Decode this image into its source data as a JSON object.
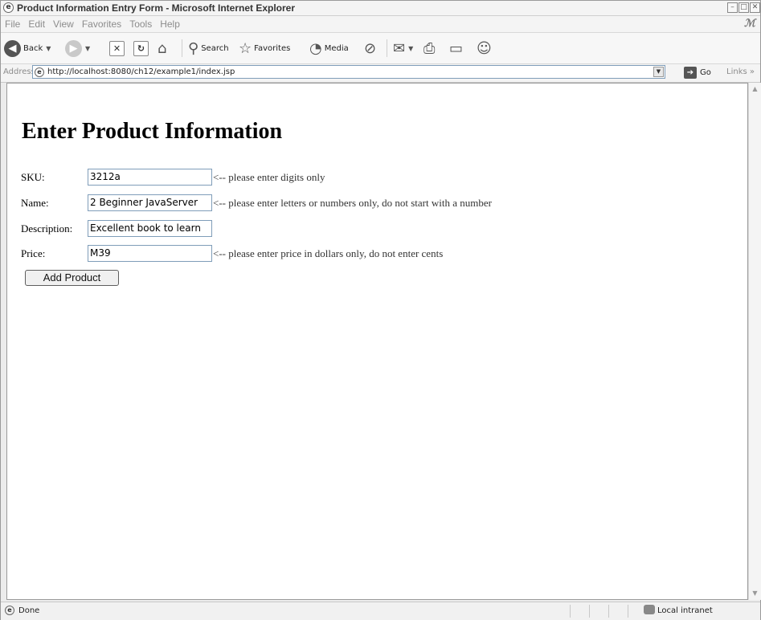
{
  "window": {
    "title": "Product Information Entry Form - Microsoft Internet Explorer",
    "controls": {
      "minimize": "–",
      "maximize": "□",
      "close": "✕"
    }
  },
  "menu": {
    "items": [
      "File",
      "Edit",
      "View",
      "Favorites",
      "Tools",
      "Help"
    ]
  },
  "toolbar": {
    "back": "Back",
    "search": "Search",
    "favorites": "Favorites",
    "media": "Media"
  },
  "address": {
    "label": "Address",
    "url": "http://localhost:8080/ch12/example1/index.jsp",
    "go": "Go",
    "links": "Links »"
  },
  "page": {
    "title": "Enter Product Information",
    "fields": [
      {
        "label": "SKU:",
        "value": "3212a",
        "hint": "<-- please enter digits only"
      },
      {
        "label": "Name:",
        "value": "2 Beginner JavaServer",
        "hint": "<-- please enter letters or numbers only, do not start with a number"
      },
      {
        "label": "Description:",
        "value": "Excellent book to learn",
        "hint": ""
      },
      {
        "label": "Price:",
        "value": "M39",
        "hint": "<-- please enter price in dollars only, do not enter cents"
      }
    ],
    "submit": "Add Product"
  },
  "status": {
    "text": "Done",
    "zone": "Local intranet"
  },
  "icons": [
    "ie-page-icon",
    "back-arrow-icon",
    "forward-arrow-icon",
    "stop-icon",
    "refresh-icon",
    "home-icon",
    "search-icon",
    "favorites-star-icon",
    "media-icon",
    "history-icon",
    "mail-icon",
    "print-icon",
    "edit-icon",
    "messenger-icon",
    "go-arrow-icon",
    "intranet-icon"
  ]
}
